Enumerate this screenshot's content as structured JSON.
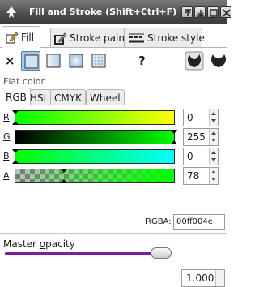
{
  "window": {
    "title": "Fill and Stroke (Shift+Ctrl+F)",
    "title_icon": "inkscape-icon",
    "buttons": [
      "dock-up-icon",
      "dock-down-icon",
      "maximize-icon",
      "close-icon"
    ]
  },
  "tabs": [
    {
      "label": "Fill",
      "icon": "fill-icon",
      "active": true
    },
    {
      "label": "Stroke paint",
      "icon": "stroke-paint-icon",
      "active": false
    },
    {
      "label": "Stroke style",
      "icon": "stroke-style-icon",
      "active": false
    }
  ],
  "paint_modes": [
    {
      "name": "no-paint",
      "glyph": "×"
    },
    {
      "name": "flat-color",
      "selected": true
    },
    {
      "name": "linear-gradient"
    },
    {
      "name": "radial-gradient"
    },
    {
      "name": "pattern"
    },
    {
      "name": "unset",
      "glyph": "?"
    }
  ],
  "fill_rules": [
    "fill-rule-evenodd-icon",
    "fill-rule-nonzero-icon"
  ],
  "flat_color_label": "Flat color",
  "color_tabs": [
    {
      "label": "RGB",
      "active": true
    },
    {
      "label": "HSL"
    },
    {
      "label": "CMYK"
    },
    {
      "label": "Wheel"
    }
  ],
  "channels": [
    {
      "label": "R",
      "value": "0",
      "fraction": 0.0
    },
    {
      "label": "G",
      "value": "255",
      "fraction": 1.0
    },
    {
      "label": "B",
      "value": "0",
      "fraction": 0.0
    },
    {
      "label": "A",
      "value": "78",
      "fraction": 0.306
    }
  ],
  "rgba": {
    "label": "RGBA:",
    "value": "00ff004e"
  },
  "master_opacity": {
    "label": "Master opacity",
    "value": "1.000",
    "fraction": 1.0
  },
  "colors": {
    "accent": "#7b1fa2",
    "selected_mode": "#a8c8e8",
    "title_bar": "#4e4e4e"
  }
}
